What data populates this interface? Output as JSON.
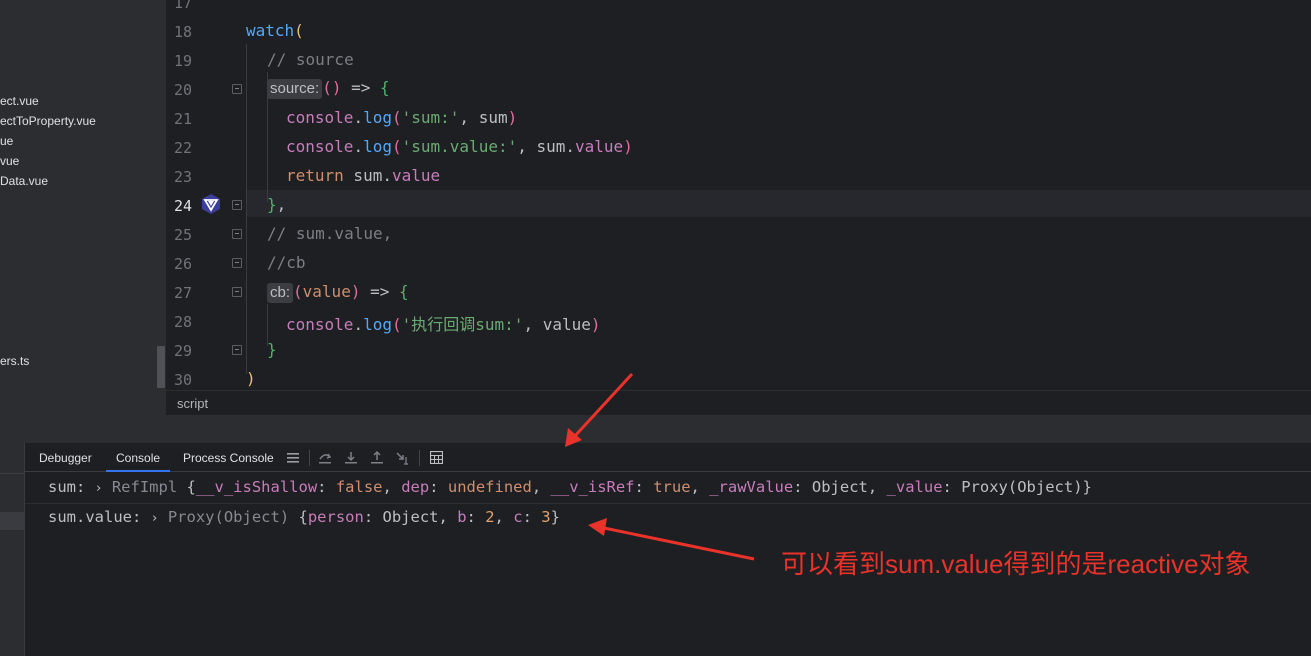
{
  "project_tree": {
    "items": [
      {
        "label": "ect.vue"
      },
      {
        "label": "ectToProperty.vue"
      },
      {
        "label": "ue"
      },
      {
        "label": "vue"
      },
      {
        "label": "Data.vue"
      },
      {
        "label": "ers.ts"
      }
    ]
  },
  "editor": {
    "line_numbers": [
      "17",
      "18",
      "19",
      "20",
      "21",
      "22",
      "23",
      "24",
      "25",
      "26",
      "27",
      "28",
      "29",
      "30"
    ],
    "lines": {
      "l18": {
        "fn": "watch",
        "paren": "("
      },
      "l19": {
        "comment": "// source"
      },
      "l20": {
        "hint": "source:",
        "sig": "()",
        "arrow": " => ",
        "brace": "{"
      },
      "l21": {
        "console": "console",
        "dot": ".",
        "method": "log",
        "open": "(",
        "str": "'sum:'",
        "rest": ", sum",
        "close": ")"
      },
      "l22": {
        "console": "console",
        "dot": ".",
        "method": "log",
        "open": "(",
        "str": "'sum.value:'",
        "mid": ", sum.",
        "prop": "value",
        "close": ")"
      },
      "l23": {
        "kw": "return",
        "mid": " sum.",
        "prop": "value"
      },
      "l24": {
        "brace": "}",
        "comma": ","
      },
      "l25": {
        "comment": "// sum.value,"
      },
      "l26": {
        "comment": "//cb"
      },
      "l27": {
        "hint": "cb:",
        "open": "(",
        "param": "value",
        "close": ")",
        "arrow": " => ",
        "brace": "{"
      },
      "l28": {
        "console": "console",
        "dot": ".",
        "method": "log",
        "open": "(",
        "str": "'执行回调sum:'",
        "rest": ", value",
        "close": ")"
      },
      "l29": {
        "brace": "}"
      },
      "l30": {
        "paren": ")"
      }
    }
  },
  "breadcrumb": {
    "label": "script"
  },
  "debug": {
    "tabs": [
      {
        "label": "Debugger"
      },
      {
        "label": "Console",
        "active": true
      },
      {
        "label": "Process Console"
      }
    ],
    "toolbar_icons": [
      "menu-icon",
      "step-over-icon",
      "step-into-icon",
      "step-out-icon",
      "run-to-cursor-icon",
      "evaluate-icon"
    ],
    "console": {
      "line1": {
        "key": "sum:",
        "expander": "›",
        "type": "RefImpl",
        "open": " {",
        "f1": "__v_isShallow",
        "v1": "false",
        "f2": "dep",
        "v2": "undefined",
        "f3": "__v_isRef",
        "v3": "true",
        "f4": "_rawValue",
        "v4": "Object",
        "f5": "_value",
        "v5": "Proxy(Object)",
        "close": "}"
      },
      "line2": {
        "key": "sum.value:",
        "expander": "›",
        "type": "Proxy(Object)",
        "open": " {",
        "f1": "person",
        "v1": "Object",
        "f2": "b",
        "v2": "2",
        "f3": "c",
        "v3": "3",
        "close": "}"
      }
    }
  },
  "annotation": {
    "text": "可以看到sum.value得到的是reactive对象",
    "color": "#e8322a"
  }
}
